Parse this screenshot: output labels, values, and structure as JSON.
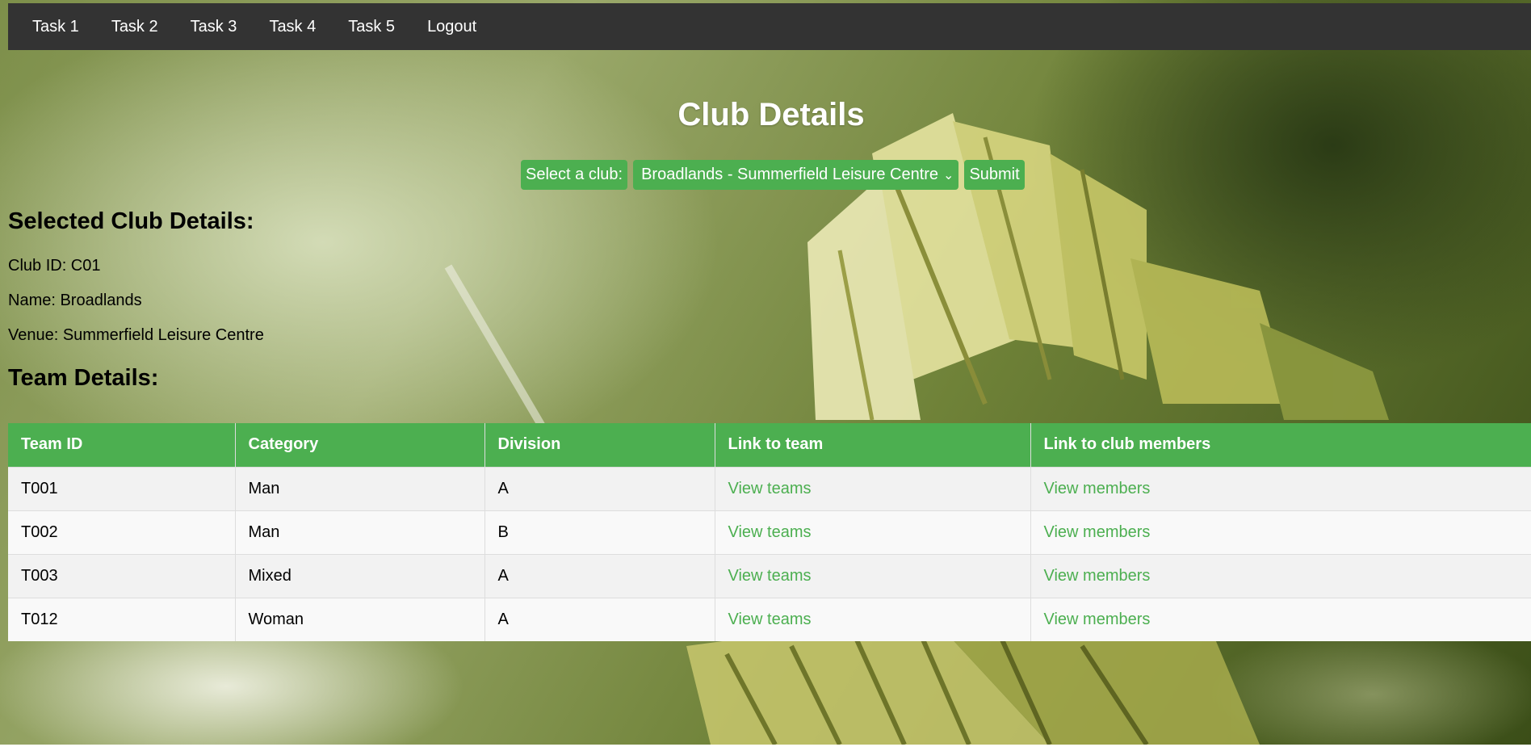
{
  "nav": {
    "items": [
      {
        "label": "Task 1"
      },
      {
        "label": "Task 2"
      },
      {
        "label": "Task 3"
      },
      {
        "label": "Task 4"
      },
      {
        "label": "Task 5"
      },
      {
        "label": "Logout"
      }
    ]
  },
  "header": {
    "title": "Club Details"
  },
  "form": {
    "select_label": "Select a club:",
    "selected_club": "Broadlands - Summerfield Leisure Centre",
    "submit_label": "Submit"
  },
  "selected_club": {
    "heading": "Selected Club Details:",
    "club_id_line": "Club ID: C01",
    "name_line": "Name: Broadlands",
    "venue_line": "Venue: Summerfield Leisure Centre"
  },
  "teams": {
    "heading": "Team Details:",
    "columns": [
      "Team ID",
      "Category",
      "Division",
      "Link to team",
      "Link to club members"
    ],
    "rows": [
      {
        "team_id": "T001",
        "category": "Man",
        "division": "A",
        "team_link": "View teams",
        "members_link": "View members"
      },
      {
        "team_id": "T002",
        "category": "Man",
        "division": "B",
        "team_link": "View teams",
        "members_link": "View members"
      },
      {
        "team_id": "T003",
        "category": "Mixed",
        "division": "A",
        "team_link": "View teams",
        "members_link": "View members"
      },
      {
        "team_id": "T012",
        "category": "Woman",
        "division": "A",
        "team_link": "View teams",
        "members_link": "View members"
      }
    ]
  },
  "colors": {
    "accent": "#4caf50",
    "navbar": "#333333"
  }
}
